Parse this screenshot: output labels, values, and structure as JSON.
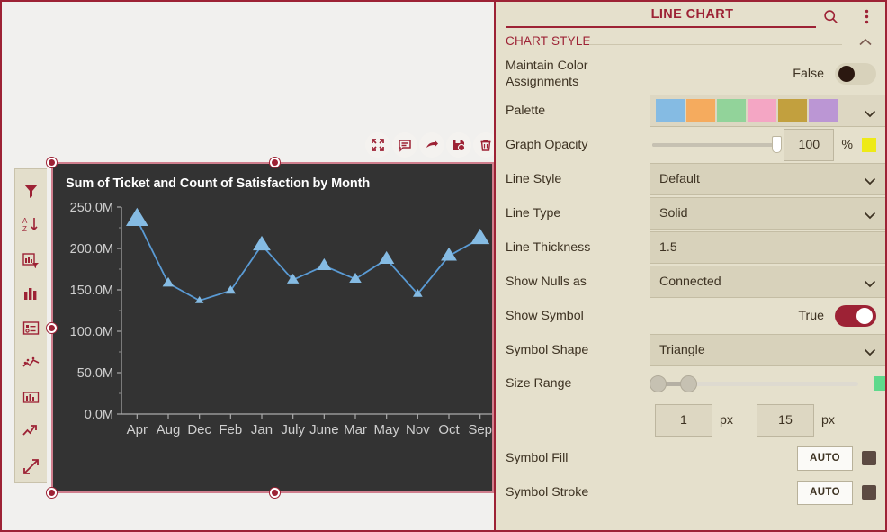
{
  "panel": {
    "title": "LINE CHART",
    "search_icon": "search-icon",
    "menu_icon": "more-vertical-icon",
    "section": {
      "label": "CHART STYLE",
      "collapse_icon": "chevron-up-icon"
    },
    "rows": {
      "maintain_color": {
        "label": "Maintain Color Assignments",
        "value": "False",
        "state": "off"
      },
      "palette": {
        "label": "Palette",
        "colors": [
          "#85bbe3",
          "#f5ab5e",
          "#92d39a",
          "#f4a6c4",
          "#c2a03e",
          "#bb96d4"
        ]
      },
      "graph_opacity": {
        "label": "Graph Opacity",
        "value": "100",
        "unit": "%",
        "percent": 100,
        "chip_color": "#eeea16"
      },
      "line_style": {
        "label": "Line Style",
        "value": "Default"
      },
      "line_type": {
        "label": "Line Type",
        "value": "Solid"
      },
      "line_thickness": {
        "label": "Line Thickness",
        "value": "1.5"
      },
      "show_nulls_as": {
        "label": "Show Nulls as",
        "value": "Connected"
      },
      "show_symbol": {
        "label": "Show Symbol",
        "value": "True",
        "state": "on"
      },
      "symbol_shape": {
        "label": "Symbol Shape",
        "value": "Triangle"
      },
      "size_range": {
        "label": "Size Range",
        "min": "1",
        "max": "15",
        "unit_min": "px",
        "unit_max": "px",
        "chip_color": "#5fd98c"
      },
      "symbol_fill": {
        "label": "Symbol Fill",
        "button": "AUTO",
        "chip_color": "#5c4a42"
      },
      "symbol_stroke": {
        "label": "Symbol Stroke",
        "button": "AUTO",
        "chip_color": "#5c4a42"
      }
    }
  },
  "chart_toolbar": {
    "items": [
      {
        "name": "fullscreen-icon",
        "label": "Fullscreen"
      },
      {
        "name": "comment-icon",
        "label": "Comment"
      },
      {
        "name": "share-icon",
        "label": "Share"
      },
      {
        "name": "save-icon",
        "label": "Save"
      },
      {
        "name": "trash-icon",
        "label": "Delete"
      }
    ]
  },
  "vertical_toolbar": {
    "items": [
      {
        "name": "filter-icon",
        "label": "Filter"
      },
      {
        "name": "sort-az-icon",
        "label": "Sort A-Z"
      },
      {
        "name": "chart-filter-icon",
        "label": "Chart Filter"
      },
      {
        "name": "bar-chart-icon",
        "label": "Bar Chart"
      },
      {
        "name": "legend-icon",
        "label": "Legend"
      },
      {
        "name": "scatter-trend-icon",
        "label": "Trend Analysis"
      },
      {
        "name": "histogram-icon",
        "label": "Histogram"
      },
      {
        "name": "trendline-icon",
        "label": "Trend Line"
      },
      {
        "name": "expand-diagonal-icon",
        "label": "Expand"
      }
    ]
  },
  "chart_data": {
    "type": "line",
    "title": "Sum of Ticket and Count of Satisfaction by Month",
    "xlabel": "",
    "ylabel": "",
    "categories": [
      "Apr",
      "Aug",
      "Dec",
      "Feb",
      "Jan",
      "July",
      "June",
      "Mar",
      "May",
      "Nov",
      "Oct",
      "Sep"
    ],
    "values": [
      235000000,
      158000000,
      137000000,
      149000000,
      204000000,
      162000000,
      179000000,
      163000000,
      187000000,
      145000000,
      191000000,
      212000000
    ],
    "ytick_labels": [
      "0.0M",
      "50.0M",
      "100.0M",
      "150.0M",
      "200.0M",
      "250.0M"
    ],
    "ytick_values": [
      0,
      50000000,
      100000000,
      150000000,
      200000000,
      250000000
    ],
    "ylim": [
      0,
      250000000
    ],
    "grid": false,
    "legend": "none",
    "series_color": "#85bbe3",
    "symbol": "triangle",
    "background": "#333333"
  }
}
